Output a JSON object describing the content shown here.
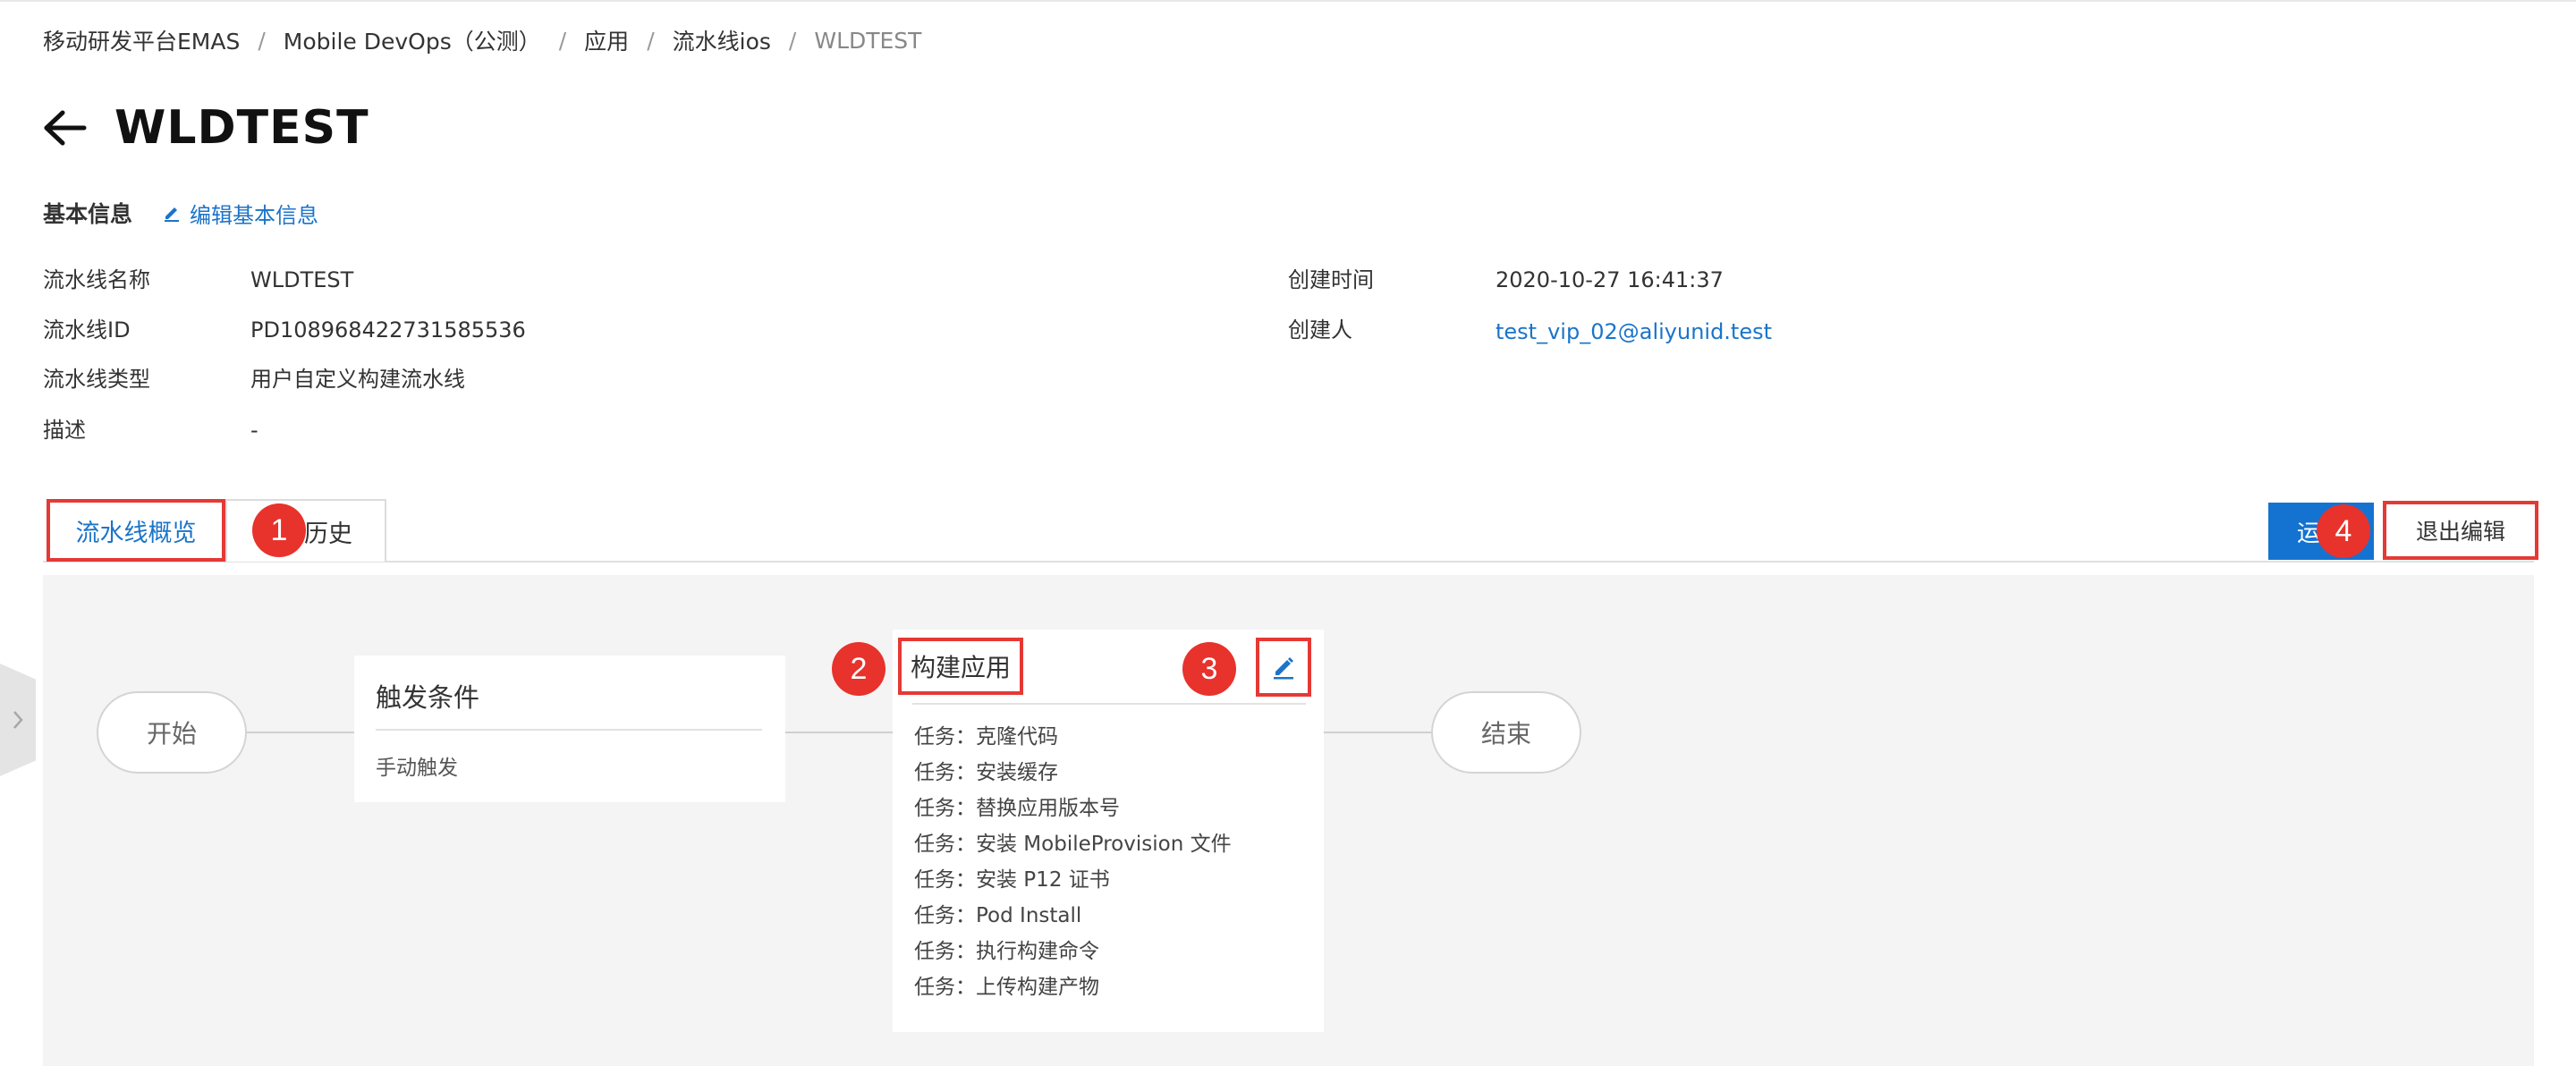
{
  "breadcrumb": {
    "items": [
      "移动研发平台EMAS",
      "Mobile DevOps（公测）",
      "应用",
      "流水线ios"
    ],
    "current": "WLDTEST",
    "separator": "/"
  },
  "header": {
    "title": "WLDTEST",
    "back_icon": "arrow-left-icon"
  },
  "basic_info": {
    "section_title": "基本信息",
    "edit_label": "编辑基本信息",
    "fields": {
      "name_label": "流水线名称",
      "name_value": "WLDTEST",
      "id_label": "流水线ID",
      "id_value": "PD108968422731585536",
      "type_label": "流水线类型",
      "type_value": "用户自定义构建流水线",
      "desc_label": "描述",
      "desc_value": "-",
      "created_time_label": "创建时间",
      "created_time_value": "2020-10-27 16:41:37",
      "creator_label": "创建人",
      "creator_value": "test_vip_02@aliyunid.test"
    }
  },
  "tabs": {
    "overview_label": "流水线概览",
    "history_label": "历史"
  },
  "actions": {
    "run_label": "运",
    "exit_edit_label": "退出编辑"
  },
  "pipeline": {
    "start_label": "开始",
    "end_label": "结束",
    "trigger": {
      "title": "触发条件",
      "text": "手动触发"
    },
    "build": {
      "title": "构建应用",
      "tasks": [
        "任务：克隆代码",
        "任务：安装缓存",
        "任务：替换应用版本号",
        "任务：安装 MobileProvision 文件",
        "任务：安装 P12 证书",
        "任务：Pod Install",
        "任务：执行构建命令",
        "任务：上传构建产物"
      ]
    }
  },
  "badges": [
    "1",
    "2",
    "3",
    "4"
  ],
  "colors": {
    "accent": "#1b74c9",
    "primary_button": "#1473d1",
    "highlight": "#e53935",
    "canvas": "#f4f4f4"
  }
}
